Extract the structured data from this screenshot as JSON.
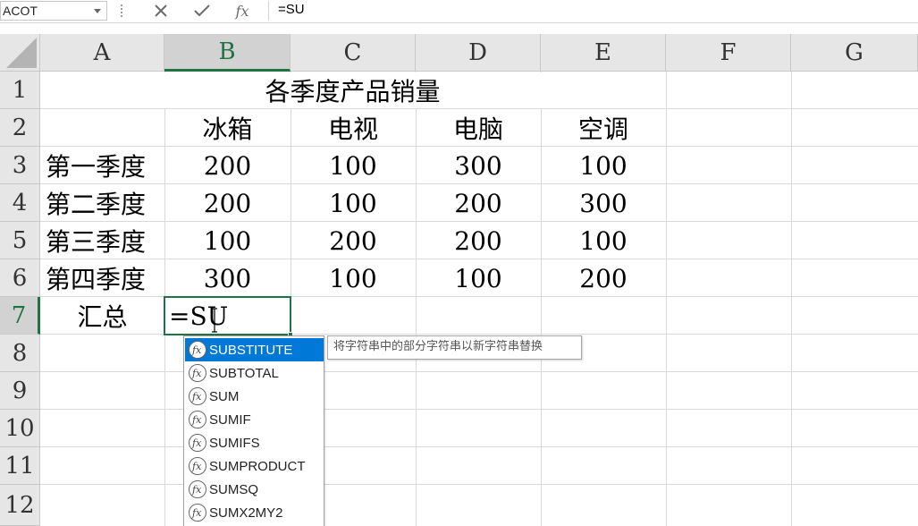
{
  "formula_bar": {
    "name_box": "ACOT",
    "formula": "=SU",
    "icons": [
      "cancel-icon",
      "enter-icon",
      "insert-function-icon"
    ]
  },
  "columns": [
    "A",
    "B",
    "C",
    "D",
    "E",
    "F",
    "G"
  ],
  "rows": [
    "1",
    "2",
    "3",
    "4",
    "5",
    "6",
    "7",
    "8",
    "9",
    "10",
    "11",
    "12"
  ],
  "sheet": {
    "title": "各季度产品销量",
    "headers": [
      "冰箱",
      "电视",
      "电脑",
      "空调"
    ],
    "quarters": [
      {
        "label": "第一季度",
        "values": [
          "200",
          "100",
          "300",
          "100"
        ]
      },
      {
        "label": "第二季度",
        "values": [
          "200",
          "100",
          "200",
          "300"
        ]
      },
      {
        "label": "第三季度",
        "values": [
          "100",
          "200",
          "200",
          "100"
        ]
      },
      {
        "label": "第四季度",
        "values": [
          "300",
          "100",
          "100",
          "200"
        ]
      }
    ],
    "summary_label": "汇总",
    "active_cell_text": "=SU"
  },
  "autocomplete": {
    "items": [
      "SUBSTITUTE",
      "SUBTOTAL",
      "SUM",
      "SUMIF",
      "SUMIFS",
      "SUMPRODUCT",
      "SUMSQ",
      "SUMX2MY2"
    ],
    "selected": "SUBSTITUTE",
    "tooltip": "将字符串中的部分字符串以新字符串替换"
  },
  "colors": {
    "accent": "#217346",
    "selection": "#0078d7",
    "header_bg": "#e6e6e6"
  }
}
